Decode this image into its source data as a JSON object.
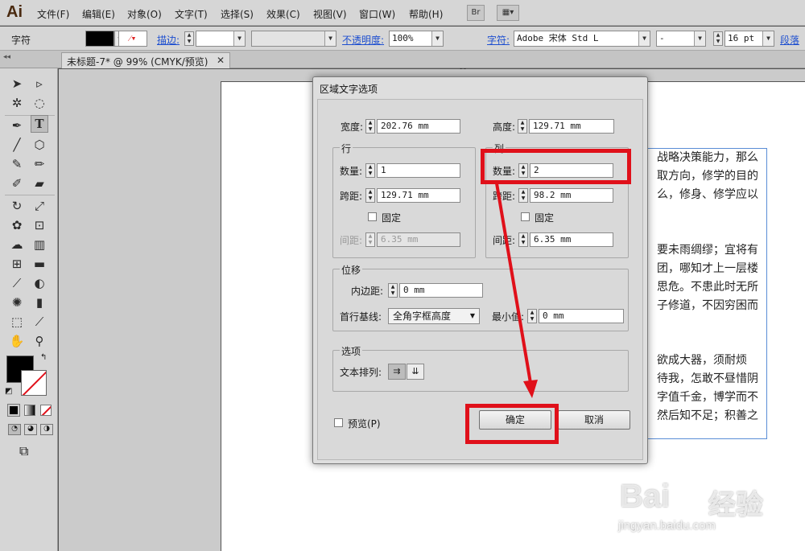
{
  "menubar": {
    "logo": "Ai",
    "items": [
      "文件(F)",
      "编辑(E)",
      "对象(O)",
      "文字(T)",
      "选择(S)",
      "效果(C)",
      "视图(V)",
      "窗口(W)",
      "帮助(H)"
    ],
    "bridge_label": "Br"
  },
  "controlbar": {
    "panel_label": "字符",
    "stroke_label": "描边:",
    "opacity_label": "不透明度:",
    "opacity_value": "100%",
    "char_label": "字符:",
    "font_value": "Adobe 宋体 Std L",
    "font_style_value": "-",
    "size_value": "16 pt",
    "para_label": "段落"
  },
  "document": {
    "tab_title": "未标题-7* @ 99% (CMYK/预览)",
    "body_lines": [
      "战略决策能力，那么",
      "取方向，修学的目的",
      "么，修身、修学应以",
      "要未雨绸缪；宜将有",
      "团，哪知才上一层楼",
      "思危。不患此时无所",
      "子修道，不因穷困而",
      "欲成大器，须耐烦",
      "待我，怎敢不昼惜阴",
      "字值千金，博学而不",
      "然后知不足；积善之"
    ]
  },
  "dialog": {
    "title": "区域文字选项",
    "width_label": "宽度:",
    "width_value": "202.76 mm",
    "height_label": "高度:",
    "height_value": "129.71 mm",
    "rows": {
      "title": "行",
      "count_label": "数量:",
      "count_value": "1",
      "span_label": "跨距:",
      "span_value": "129.71 mm",
      "fixed_label": "固定",
      "gutter_label": "间距:",
      "gutter_value": "6.35 mm"
    },
    "cols": {
      "title": "列",
      "count_label": "数量:",
      "count_value": "2",
      "span_label": "跨距:",
      "span_value": "98.2 mm",
      "fixed_label": "固定",
      "gutter_label": "间距:",
      "gutter_value": "6.35 mm"
    },
    "offset": {
      "title": "位移",
      "inset_label": "内边距:",
      "inset_value": "0 mm",
      "baseline_label": "首行基线:",
      "baseline_value": "全角字框高度",
      "min_label": "最小值:",
      "min_value": "0 mm"
    },
    "options": {
      "title": "选项",
      "flow_label": "文本排列:"
    },
    "preview_label": "预览(P)",
    "ok_label": "确定",
    "cancel_label": "取消"
  },
  "watermark": {
    "brand": "Bai",
    "brand_cn": "经验",
    "url": "jingyan.baidu.com"
  },
  "colors": {
    "annotation": "#e0101a",
    "link": "#1e4fd0"
  }
}
